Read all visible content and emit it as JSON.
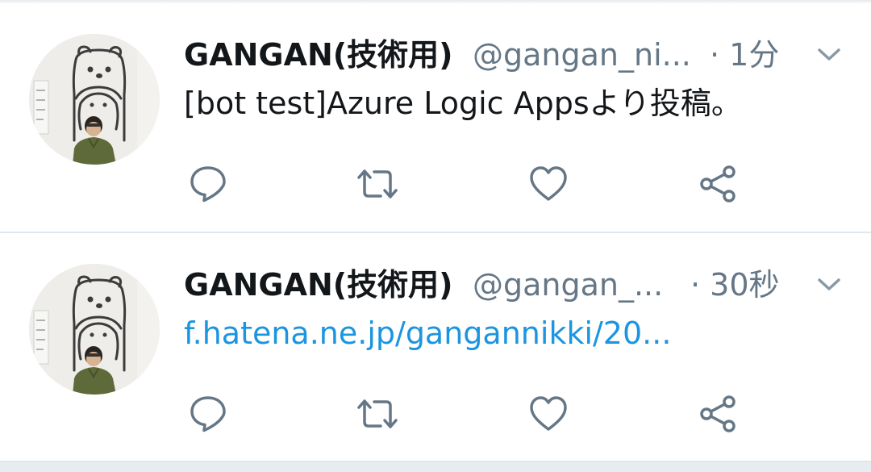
{
  "tweets": [
    {
      "display_name": "GANGAN(技術用)",
      "handle": "@gangan_ni...",
      "time": "· 1分",
      "body": "[bot test]Azure Logic Appsより投稿。",
      "body_is_link": false
    },
    {
      "display_name": "GANGAN(技術用)",
      "handle": "@gangan_...",
      "time": "· 30秒",
      "body": "f.hatena.ne.jp/gangannikki/20...",
      "body_is_link": true
    }
  ],
  "actions": {
    "reply_icon": "reply-icon",
    "retweet_icon": "retweet-icon",
    "like_icon": "heart-icon",
    "share_icon": "share-icon"
  },
  "colors": {
    "text_primary": "#14171a",
    "text_secondary": "#657786",
    "link": "#1b95e0",
    "divider": "#e1e8ed",
    "bottom_band": "#e6ecf0"
  }
}
